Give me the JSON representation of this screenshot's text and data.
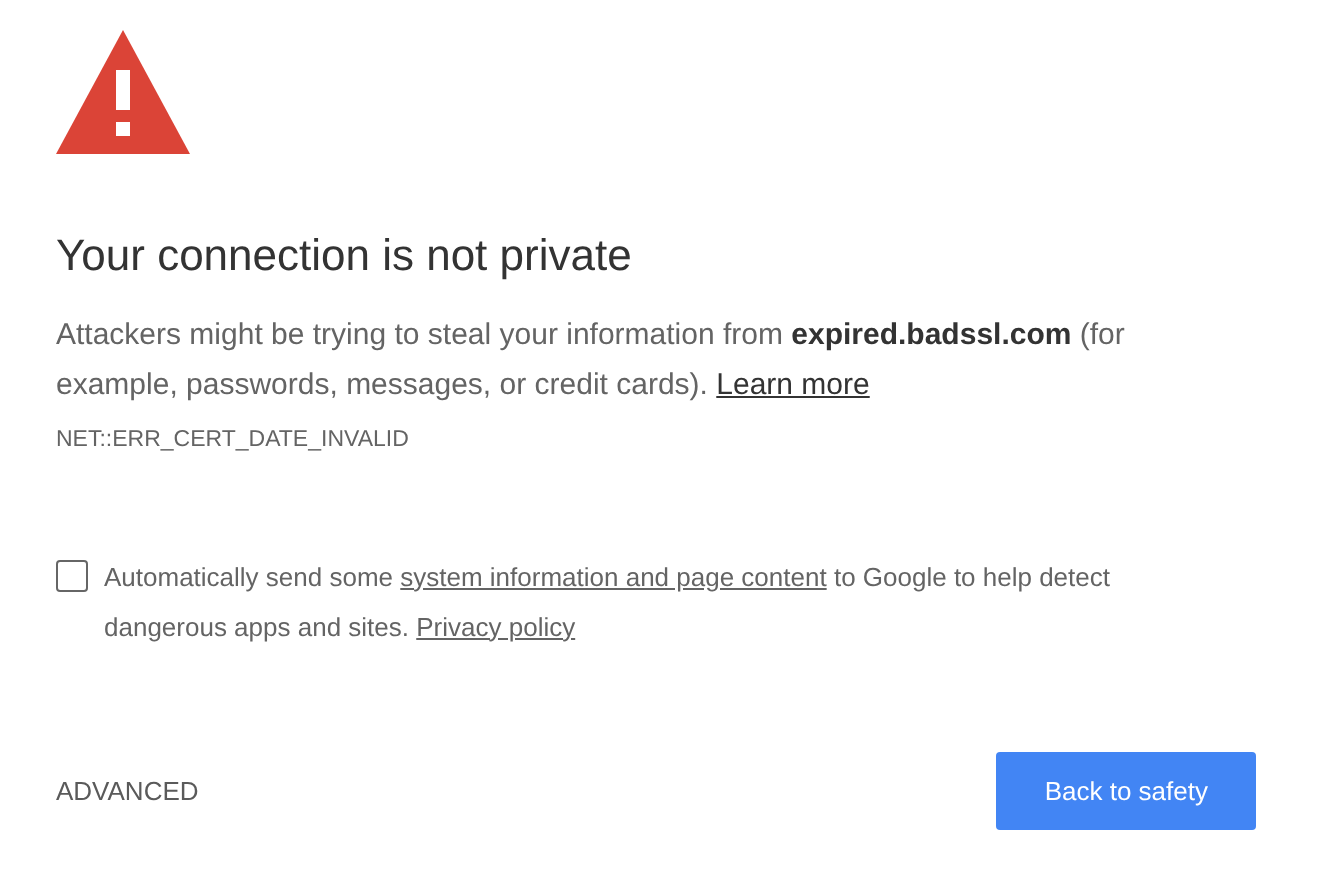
{
  "title": "Your connection is not private",
  "message": "Attackers might be trying to steal your information from **expired.badssl.com** (for example, passwords, messages, or credit cards).",
  "learn_more": "Learn more",
  "error_code": "NET::ERR_CERT_DATE_INVALID",
  "report": {
    "checked": false,
    "before": "Automatically send some",
    "link1": "system information and page content",
    "middle": "to Google to help detect dangerous apps and sites.",
    "link2": "Privacy policy"
  },
  "advanced": "ADVANCED",
  "back_button": "Back to safety"
}
